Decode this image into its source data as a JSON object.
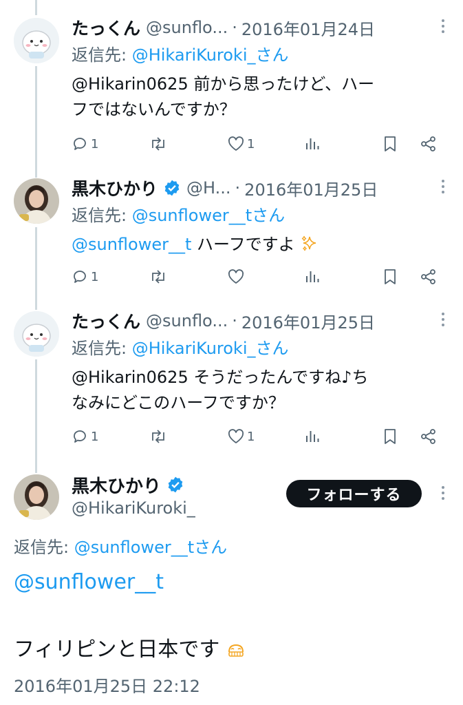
{
  "colors": {
    "link": "#1d9bf0",
    "secondary": "#536471",
    "primary": "#0f1419",
    "verified": "#1d9bf0"
  },
  "tweets": [
    {
      "name": "たっくん",
      "handle": "@sunflo...",
      "separator": "·",
      "date": "2016年01月24日",
      "reply_label": "返信先: ",
      "reply_target": "@HikariKuroki_さん",
      "text_line1": "@Hikarin0625 前から思ったけど、ハー",
      "text_line2": "フではないんですか？",
      "reply_count": "1",
      "like_count": "1",
      "avatar": "cartoon-chick-avatar"
    },
    {
      "name": "黒木ひかり",
      "handle": "@H...",
      "separator": "·",
      "date": "2016年01月25日",
      "reply_label": "返信先: ",
      "reply_target": "@sunflower__tさん",
      "mention": "@sunflower__t",
      "text": " ハーフですよ",
      "emoji": "sparkles-icon",
      "reply_count": "1",
      "like_count": "",
      "avatar": "woman-photo-avatar"
    },
    {
      "name": "たっくん",
      "handle": "@sunflo...",
      "separator": "·",
      "date": "2016年01月25日",
      "reply_label": "返信先: ",
      "reply_target": "@HikariKuroki_さん",
      "text_line1": "@Hikarin0625 そうだったんですね♪ち",
      "text_line2": "なみにどこのハーフですか？",
      "reply_count": "1",
      "like_count": "1",
      "avatar": "cartoon-chick-avatar"
    }
  ],
  "main_tweet": {
    "name": "黒木ひかり",
    "handle": "@HikariKuroki_",
    "follow_label": "フォローする",
    "reply_label": "返信先: ",
    "reply_target": "@sunflower__tさん",
    "mention": "@sunflower__t",
    "text": "フィリピンと日本です",
    "emoji": "tears-of-joy-icon",
    "timestamp": "2016年01月25日 22:12",
    "avatar": "woman-photo-avatar"
  }
}
